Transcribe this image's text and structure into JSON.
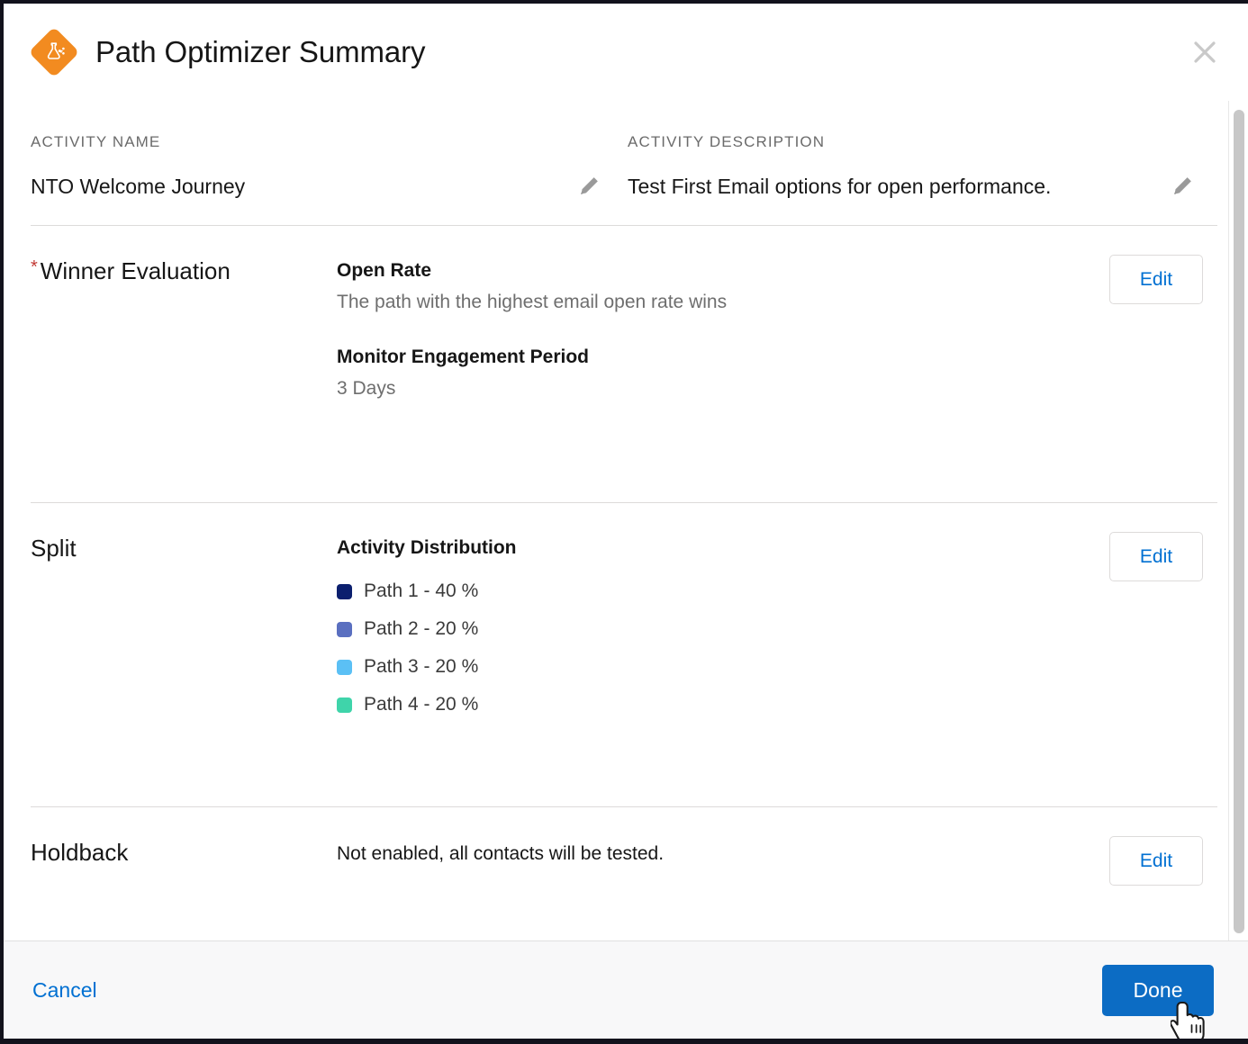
{
  "window": {
    "title": "Path Optimizer Summary",
    "app_icon": "flask-path-optimizer-icon",
    "close_icon": "close-icon"
  },
  "fields": {
    "activity_name": {
      "label": "ACTIVITY NAME",
      "value": "NTO Welcome Journey",
      "edit_icon": "pencil-icon"
    },
    "activity_description": {
      "label": "ACTIVITY DESCRIPTION",
      "value": "Test First Email options for open performance.",
      "edit_icon": "pencil-icon"
    }
  },
  "sections": {
    "winner_evaluation": {
      "label": "Winner Evaluation",
      "required_marker": "*",
      "criteria_title": "Open Rate",
      "criteria_desc": "The path with the highest email open rate wins",
      "period_title": "Monitor Engagement Period",
      "period_value": "3 Days",
      "edit_label": "Edit"
    },
    "split": {
      "label": "Split",
      "distribution_title": "Activity Distribution",
      "paths": [
        {
          "label": "Path 1 - 40 %",
          "color": "#0b1f6e"
        },
        {
          "label": "Path 2 - 20 %",
          "color": "#5a6fc0"
        },
        {
          "label": "Path 3 - 20 %",
          "color": "#5bc0f5"
        },
        {
          "label": "Path 4 - 20 %",
          "color": "#3fd4aa"
        }
      ],
      "edit_label": "Edit"
    },
    "holdback": {
      "label": "Holdback",
      "value": "Not enabled, all contacts will be tested.",
      "edit_label": "Edit"
    }
  },
  "footer": {
    "cancel_label": "Cancel",
    "done_label": "Done"
  },
  "colors": {
    "brand_orange": "#f28b20",
    "link_blue": "#0070d2",
    "primary_blue": "#0c6cc4",
    "required_red": "#c23934"
  }
}
